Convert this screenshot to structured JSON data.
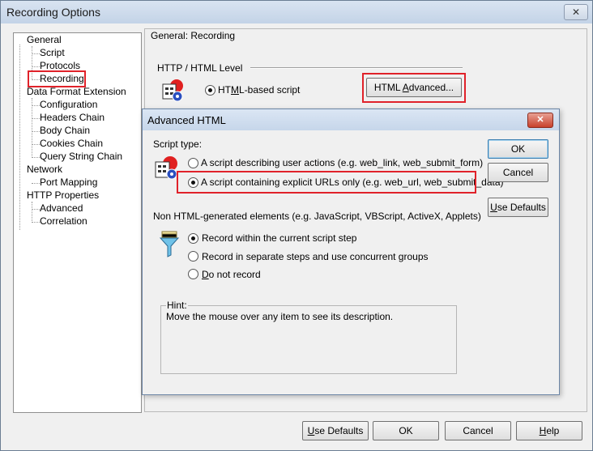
{
  "window": {
    "title": "Recording Options",
    "close": "✕"
  },
  "tree": {
    "items": [
      {
        "label": "General"
      },
      {
        "label": "Script"
      },
      {
        "label": "Protocols"
      },
      {
        "label": "Recording"
      },
      {
        "label": "Data Format Extension"
      },
      {
        "label": "Configuration"
      },
      {
        "label": "Headers Chain"
      },
      {
        "label": "Body Chain"
      },
      {
        "label": "Cookies Chain"
      },
      {
        "label": "Query String Chain"
      },
      {
        "label": "Network"
      },
      {
        "label": "Port Mapping"
      },
      {
        "label": "HTTP Properties"
      },
      {
        "label": "Advanced"
      },
      {
        "label": "Correlation"
      }
    ]
  },
  "panel": {
    "heading": "General: Recording",
    "group_http": "HTTP / HTML Level",
    "html_based": {
      "pre": "HT",
      "key": "M",
      "post": "L-based script"
    },
    "html_advanced": {
      "pre": "HTML ",
      "key": "A",
      "post": "dvanced..."
    }
  },
  "dialog": {
    "title": "Advanced HTML",
    "close": "✕",
    "script_type_label": "Script type:",
    "opt_user_actions": "A script describing user actions (e.g. web_link, web_submit_form)",
    "opt_explicit": "A script containing explicit URLs only (e.g. web_url, web_submit_data)",
    "ok": "OK",
    "cancel": "Cancel",
    "use_defaults": {
      "key": "U",
      "post": "se Defaults"
    },
    "non_html_label": "Non HTML-generated elements (e.g. JavaScript, VBScript, ActiveX, Applets)",
    "rec_within": "Record within the current script step",
    "rec_separate": "Record in separate steps and use concurrent groups",
    "do_not_record": {
      "key": "D",
      "post": "o not record"
    },
    "hint_label": "Hint:",
    "hint_text": "Move the mouse over any item to see its description."
  },
  "footer": {
    "use_defaults": {
      "key": "U",
      "post": "se Defaults"
    },
    "ok": "OK",
    "cancel": "Cancel",
    "help": {
      "key": "H",
      "post": "elp"
    }
  },
  "colors": {
    "highlight": "#e0222a",
    "title_gradient_top": "#d9e4f1",
    "dialog_close": "#c8412c"
  }
}
